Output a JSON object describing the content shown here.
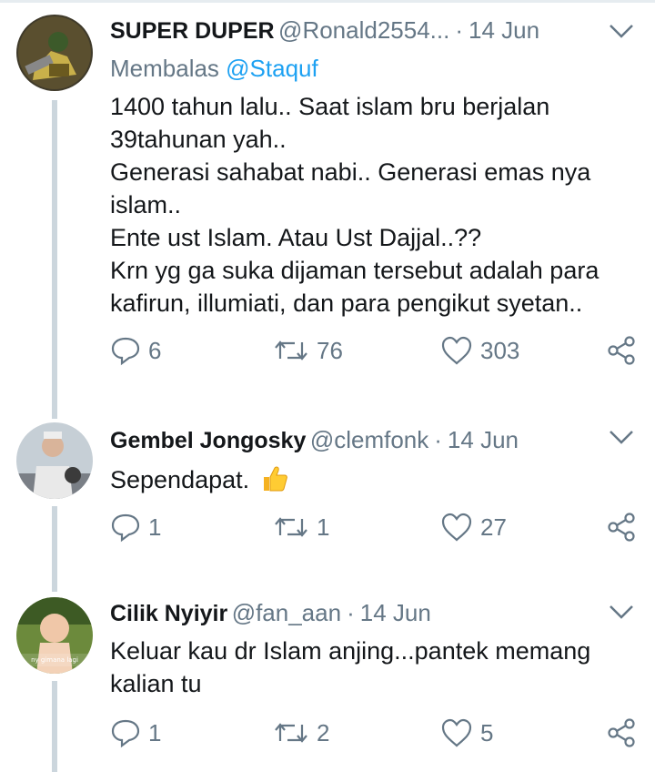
{
  "tweets": [
    {
      "name": "SUPER DUPER",
      "handle": "@Ronald2554...",
      "date": "14 Jun",
      "reply_prefix": "Membalas ",
      "reply_mention": "@Staquf",
      "lines": [
        "1400 tahun lalu.. Saat islam bru berjalan",
        "39tahunan yah..",
        "Generasi sahabat nabi.. Generasi emas nya",
        "islam..",
        "Ente ust Islam. Atau Ust Dajjal..??",
        "Krn yg ga suka dijaman tersebut adalah para",
        "kafirun, illumiati, dan para pengikut syetan.."
      ],
      "replies": "6",
      "retweets": "76",
      "likes": "303"
    },
    {
      "name": "Gembel Jongosky",
      "handle": "@clemfonk",
      "date": "14 Jun",
      "lines": [
        "Sependapat."
      ],
      "emoji": "thumbs-up",
      "replies": "1",
      "retweets": "1",
      "likes": "27"
    },
    {
      "name": "Cilik Nyiyir",
      "handle": "@fan_aan",
      "date": "14 Jun",
      "lines": [
        "Keluar kau dr Islam anjing...pantek memang",
        "kalian tu"
      ],
      "avatar_caption": "ny gimana lagi",
      "replies": "1",
      "retweets": "2",
      "likes": "5"
    }
  ],
  "colors": {
    "muted": "#657786",
    "link": "#1da1f2",
    "line": "#ccd6dd",
    "text": "#14171a"
  }
}
